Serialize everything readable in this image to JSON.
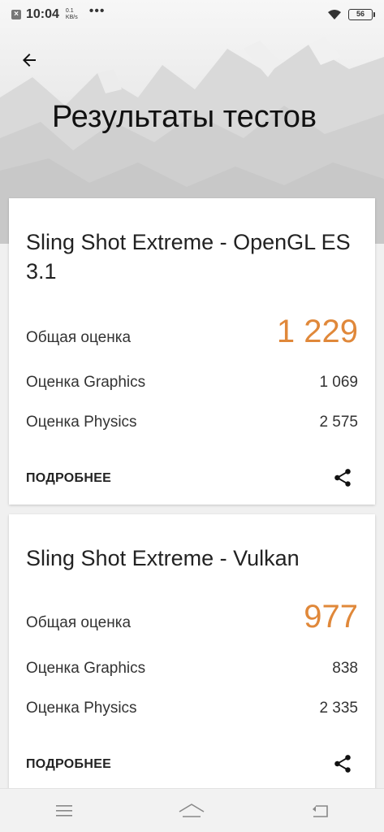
{
  "status_bar": {
    "time": "10:04",
    "speed_value": "0.1",
    "speed_unit": "KB/s",
    "more": "•••",
    "battery": "56"
  },
  "header": {
    "title": "Результаты тестов"
  },
  "results": [
    {
      "test_name": "Sling Shot Extreme - OpenGL ES 3.1",
      "total_label": "Общая оценка",
      "total_score": "1 229",
      "graphics_label": "Оценка Graphics",
      "graphics_score": "1 069",
      "physics_label": "Оценка Physics",
      "physics_score": "2 575",
      "details_label": "ПОДРОБНЕЕ"
    },
    {
      "test_name": "Sling Shot Extreme - Vulkan",
      "total_label": "Общая оценка",
      "total_score": "977",
      "graphics_label": "Оценка Graphics",
      "graphics_score": "838",
      "physics_label": "Оценка Physics",
      "physics_score": "2 335",
      "details_label": "ПОДРОБНЕЕ"
    }
  ],
  "colors": {
    "accent_score": "#e0883a",
    "card_background": "#ffffff"
  },
  "icons": {
    "back": "arrow-left-icon",
    "share": "share-icon",
    "nav_menu": "menu-icon",
    "nav_home": "home-icon",
    "nav_back": "back-icon"
  }
}
